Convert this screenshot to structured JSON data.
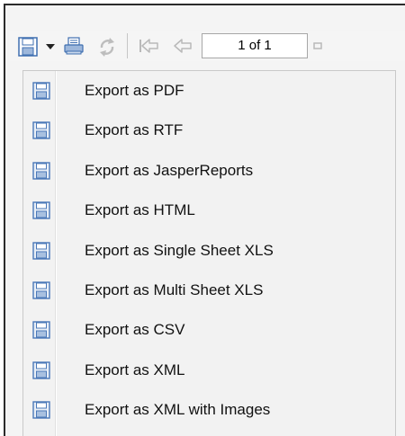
{
  "toolbar": {
    "save_icon": "save-icon",
    "dropdown_icon": "dropdown-arrow-icon",
    "print_icon": "print-icon",
    "reload_icon": "reload-icon",
    "first_page_icon": "first-page-icon",
    "prev_page_icon": "previous-page-icon",
    "page_indicator": "1 of 1",
    "next_page_icon": "next-page-icon"
  },
  "menu": {
    "items": [
      {
        "label": "Export as PDF",
        "icon": "save-icon"
      },
      {
        "label": "Export as RTF",
        "icon": "save-icon"
      },
      {
        "label": "Export as JasperReports",
        "icon": "save-icon"
      },
      {
        "label": "Export as HTML",
        "icon": "save-icon"
      },
      {
        "label": "Export as Single Sheet XLS",
        "icon": "save-icon"
      },
      {
        "label": "Export as Multi Sheet XLS",
        "icon": "save-icon"
      },
      {
        "label": "Export as CSV",
        "icon": "save-icon"
      },
      {
        "label": "Export as XML",
        "icon": "save-icon"
      },
      {
        "label": "Export as XML with Images",
        "icon": "save-icon"
      }
    ]
  },
  "colors": {
    "icon_blue": "#4a78b8",
    "icon_light": "#d7e3f2",
    "disabled_gray": "#b8b8b8"
  }
}
